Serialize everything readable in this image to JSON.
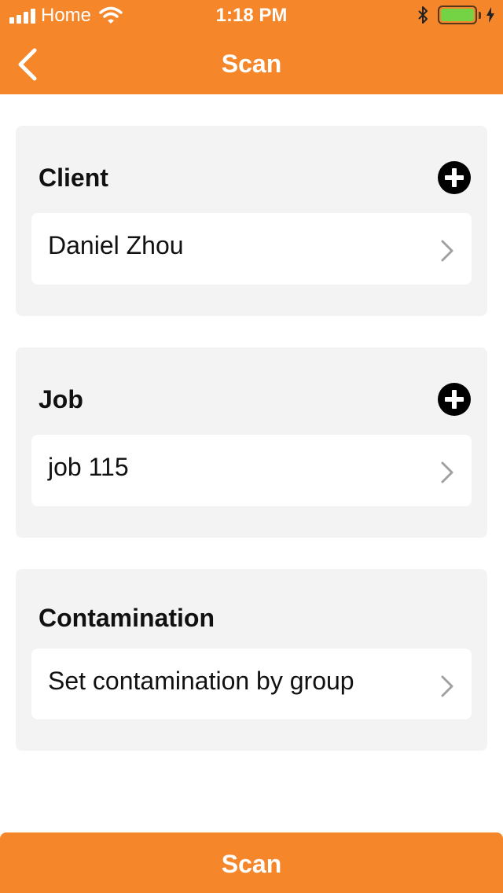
{
  "status_bar": {
    "carrier": "Home",
    "time": "1:18 PM",
    "icons": [
      "signal-icon",
      "wifi-icon",
      "bluetooth-icon",
      "battery-icon",
      "charging-icon"
    ],
    "battery_color": "#5ee04a"
  },
  "nav": {
    "title": "Scan",
    "back_icon": "chevron-left-icon"
  },
  "sections": {
    "client": {
      "title": "Client",
      "value": "Daniel Zhou",
      "add_icon": "add-circle-icon"
    },
    "job": {
      "title": "Job",
      "value": "job 115",
      "add_icon": "add-circle-icon"
    },
    "contamination": {
      "title": "Contamination",
      "value": "Set contamination by group"
    }
  },
  "footer": {
    "scan_label": "Scan"
  },
  "colors": {
    "accent": "#f5862a",
    "card_bg": "#f3f3f3",
    "row_bg": "#ffffff"
  }
}
